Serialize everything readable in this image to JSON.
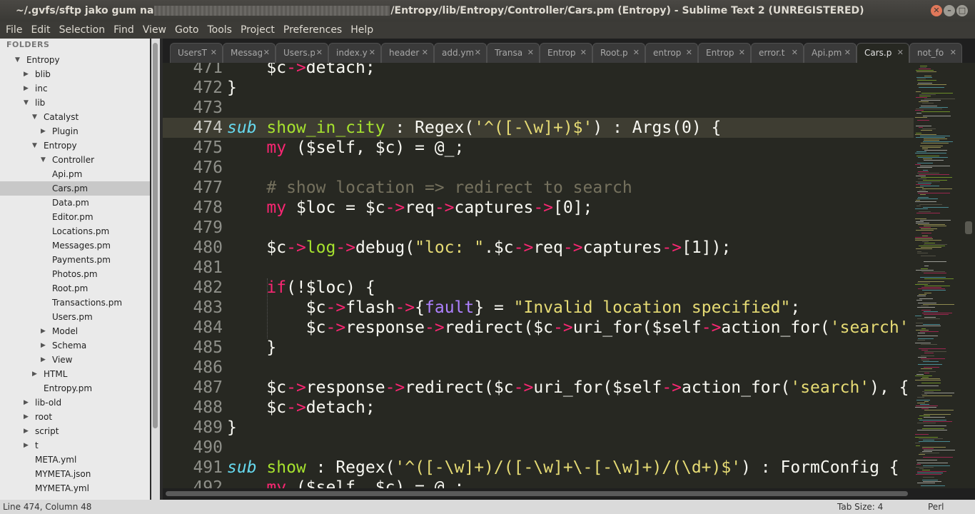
{
  "window": {
    "title_prefix": "~/.gvfs/sftp jako gum na",
    "title_suffix": "/Entropy/lib/Entropy/Controller/Cars.pm (Entropy) - Sublime Text 2 (UNREGISTERED)"
  },
  "menu": [
    "File",
    "Edit",
    "Selection",
    "Find",
    "View",
    "Goto",
    "Tools",
    "Project",
    "Preferences",
    "Help"
  ],
  "sidebar": {
    "header": "FOLDERS",
    "items": [
      {
        "label": "Entropy",
        "depth": 0,
        "state": "open"
      },
      {
        "label": "blib",
        "depth": 1,
        "state": "closed"
      },
      {
        "label": "inc",
        "depth": 1,
        "state": "closed"
      },
      {
        "label": "lib",
        "depth": 1,
        "state": "open"
      },
      {
        "label": "Catalyst",
        "depth": 2,
        "state": "open"
      },
      {
        "label": "Plugin",
        "depth": 3,
        "state": "closed"
      },
      {
        "label": "Entropy",
        "depth": 2,
        "state": "open"
      },
      {
        "label": "Controller",
        "depth": 3,
        "state": "open"
      },
      {
        "label": "Api.pm",
        "depth": 4,
        "state": "file"
      },
      {
        "label": "Cars.pm",
        "depth": 4,
        "state": "file",
        "selected": true
      },
      {
        "label": "Data.pm",
        "depth": 4,
        "state": "file"
      },
      {
        "label": "Editor.pm",
        "depth": 4,
        "state": "file"
      },
      {
        "label": "Locations.pm",
        "depth": 4,
        "state": "file"
      },
      {
        "label": "Messages.pm",
        "depth": 4,
        "state": "file"
      },
      {
        "label": "Payments.pm",
        "depth": 4,
        "state": "file"
      },
      {
        "label": "Photos.pm",
        "depth": 4,
        "state": "file"
      },
      {
        "label": "Root.pm",
        "depth": 4,
        "state": "file"
      },
      {
        "label": "Transactions.pm",
        "depth": 4,
        "state": "file"
      },
      {
        "label": "Users.pm",
        "depth": 4,
        "state": "file"
      },
      {
        "label": "Model",
        "depth": 3,
        "state": "closed"
      },
      {
        "label": "Schema",
        "depth": 3,
        "state": "closed"
      },
      {
        "label": "View",
        "depth": 3,
        "state": "closed"
      },
      {
        "label": "HTML",
        "depth": 2,
        "state": "closed"
      },
      {
        "label": "Entropy.pm",
        "depth": 3,
        "state": "file"
      },
      {
        "label": "lib-old",
        "depth": 1,
        "state": "closed"
      },
      {
        "label": "root",
        "depth": 1,
        "state": "closed"
      },
      {
        "label": "script",
        "depth": 1,
        "state": "closed"
      },
      {
        "label": "t",
        "depth": 1,
        "state": "closed"
      },
      {
        "label": "META.yml",
        "depth": 2,
        "state": "file"
      },
      {
        "label": "MYMETA.json",
        "depth": 2,
        "state": "file"
      },
      {
        "label": "MYMETA.yml",
        "depth": 2,
        "state": "file"
      }
    ]
  },
  "tabs": [
    {
      "label": "UsersT"
    },
    {
      "label": "Messag"
    },
    {
      "label": "Users.p"
    },
    {
      "label": "index.y"
    },
    {
      "label": "header"
    },
    {
      "label": "add.ym"
    },
    {
      "label": "Transa"
    },
    {
      "label": "Entrop"
    },
    {
      "label": "Root.p"
    },
    {
      "label": "entrop"
    },
    {
      "label": "Entrop"
    },
    {
      "label": "error.t"
    },
    {
      "label": "Api.pm"
    },
    {
      "label": "Cars.p",
      "active": true
    },
    {
      "label": "not_fo"
    }
  ],
  "tab_close_glyph": "✕",
  "editor": {
    "current_line": 474,
    "lines": [
      {
        "n": "471",
        "t": [
          [
            "    ",
            ""
          ],
          [
            "$c",
            ""
          ],
          [
            "->",
            "o"
          ],
          [
            "detach;",
            ""
          ]
        ]
      },
      {
        "n": "472",
        "t": [
          [
            "}",
            ""
          ]
        ]
      },
      {
        "n": "473",
        "t": []
      },
      {
        "n": "474",
        "t": [
          [
            "sub",
            "k"
          ],
          [
            " ",
            ""
          ],
          [
            "show_in_city",
            "f"
          ],
          [
            " : Regex(",
            ""
          ],
          [
            "'^([-\\w]+)$'",
            "s"
          ],
          [
            ") : Args(",
            ""
          ],
          [
            "0",
            ""
          ],
          [
            ") {",
            ""
          ]
        ]
      },
      {
        "n": "475",
        "t": [
          [
            "    ",
            ""
          ],
          [
            "my",
            "o"
          ],
          [
            " ($self, $c) = @_;",
            ""
          ]
        ]
      },
      {
        "n": "476",
        "t": []
      },
      {
        "n": "477",
        "t": [
          [
            "    ",
            ""
          ],
          [
            "# show location => redirect to search",
            "c"
          ]
        ]
      },
      {
        "n": "478",
        "t": [
          [
            "    ",
            ""
          ],
          [
            "my",
            "o"
          ],
          [
            " $loc = $c",
            ""
          ],
          [
            "->",
            "o"
          ],
          [
            "req",
            ""
          ],
          [
            "->",
            "o"
          ],
          [
            "captures",
            ""
          ],
          [
            "->",
            "o"
          ],
          [
            "[0];",
            ""
          ]
        ]
      },
      {
        "n": "479",
        "t": []
      },
      {
        "n": "480",
        "t": [
          [
            "    ",
            ""
          ],
          [
            "$c",
            ""
          ],
          [
            "->",
            "o"
          ],
          [
            "log",
            "f"
          ],
          [
            "->",
            "o"
          ],
          [
            "debug(",
            ""
          ],
          [
            "\"loc: \"",
            "s"
          ],
          [
            ".$c",
            ""
          ],
          [
            "->",
            "o"
          ],
          [
            "req",
            ""
          ],
          [
            "->",
            "o"
          ],
          [
            "captures",
            ""
          ],
          [
            "->",
            "o"
          ],
          [
            "[1]);",
            ""
          ]
        ]
      },
      {
        "n": "481",
        "t": []
      },
      {
        "n": "482",
        "t": [
          [
            "    ",
            ""
          ],
          [
            "if",
            "o"
          ],
          [
            "(!$loc) {",
            ""
          ]
        ]
      },
      {
        "n": "483",
        "t": [
          [
            "        ",
            ""
          ],
          [
            "$c",
            ""
          ],
          [
            "->",
            "o"
          ],
          [
            "flash",
            ""
          ],
          [
            "->",
            "o"
          ],
          [
            "{",
            ""
          ],
          [
            "fault",
            "h"
          ],
          [
            "} = ",
            ""
          ],
          [
            "\"Invalid location specified\"",
            "s"
          ],
          [
            ";",
            ""
          ]
        ]
      },
      {
        "n": "484",
        "t": [
          [
            "        ",
            ""
          ],
          [
            "$c",
            ""
          ],
          [
            "->",
            "o"
          ],
          [
            "response",
            ""
          ],
          [
            "->",
            "o"
          ],
          [
            "redirect($c",
            ""
          ],
          [
            "->",
            "o"
          ],
          [
            "uri_for($self",
            ""
          ],
          [
            "->",
            "o"
          ],
          [
            "action_for(",
            ""
          ],
          [
            "'search'",
            "s"
          ]
        ]
      },
      {
        "n": "485",
        "t": [
          [
            "    }",
            ""
          ]
        ]
      },
      {
        "n": "486",
        "t": []
      },
      {
        "n": "487",
        "t": [
          [
            "    ",
            ""
          ],
          [
            "$c",
            ""
          ],
          [
            "->",
            "o"
          ],
          [
            "response",
            ""
          ],
          [
            "->",
            "o"
          ],
          [
            "redirect($c",
            ""
          ],
          [
            "->",
            "o"
          ],
          [
            "uri_for($self",
            ""
          ],
          [
            "->",
            "o"
          ],
          [
            "action_for(",
            ""
          ],
          [
            "'search'",
            "s"
          ],
          [
            "), {",
            ""
          ]
        ]
      },
      {
        "n": "488",
        "t": [
          [
            "    ",
            ""
          ],
          [
            "$c",
            ""
          ],
          [
            "->",
            "o"
          ],
          [
            "detach;",
            ""
          ]
        ]
      },
      {
        "n": "489",
        "t": [
          [
            "}",
            ""
          ]
        ]
      },
      {
        "n": "490",
        "t": []
      },
      {
        "n": "491",
        "t": [
          [
            "sub",
            "k"
          ],
          [
            " ",
            ""
          ],
          [
            "show",
            "f"
          ],
          [
            " : Regex(",
            ""
          ],
          [
            "'^([-\\w]+)/([-\\w]+\\-[-\\w]+)/(\\d+)$'",
            "s"
          ],
          [
            ") : FormConfig {",
            ""
          ]
        ]
      },
      {
        "n": "492",
        "t": [
          [
            "    ",
            ""
          ],
          [
            "my",
            "o"
          ],
          [
            " ($self, $c) = @_;",
            ""
          ]
        ]
      }
    ]
  },
  "status": {
    "position": "Line 474, Column 48",
    "tab_size": "Tab Size: 4",
    "syntax": "Perl"
  },
  "colors": {
    "editor_bg": "#272822",
    "keyword": "#66d9ef",
    "function": "#a6e22e",
    "string": "#e6db74",
    "operator": "#f92672",
    "comment": "#75715e",
    "sidebar_bg": "#eaeaea"
  }
}
